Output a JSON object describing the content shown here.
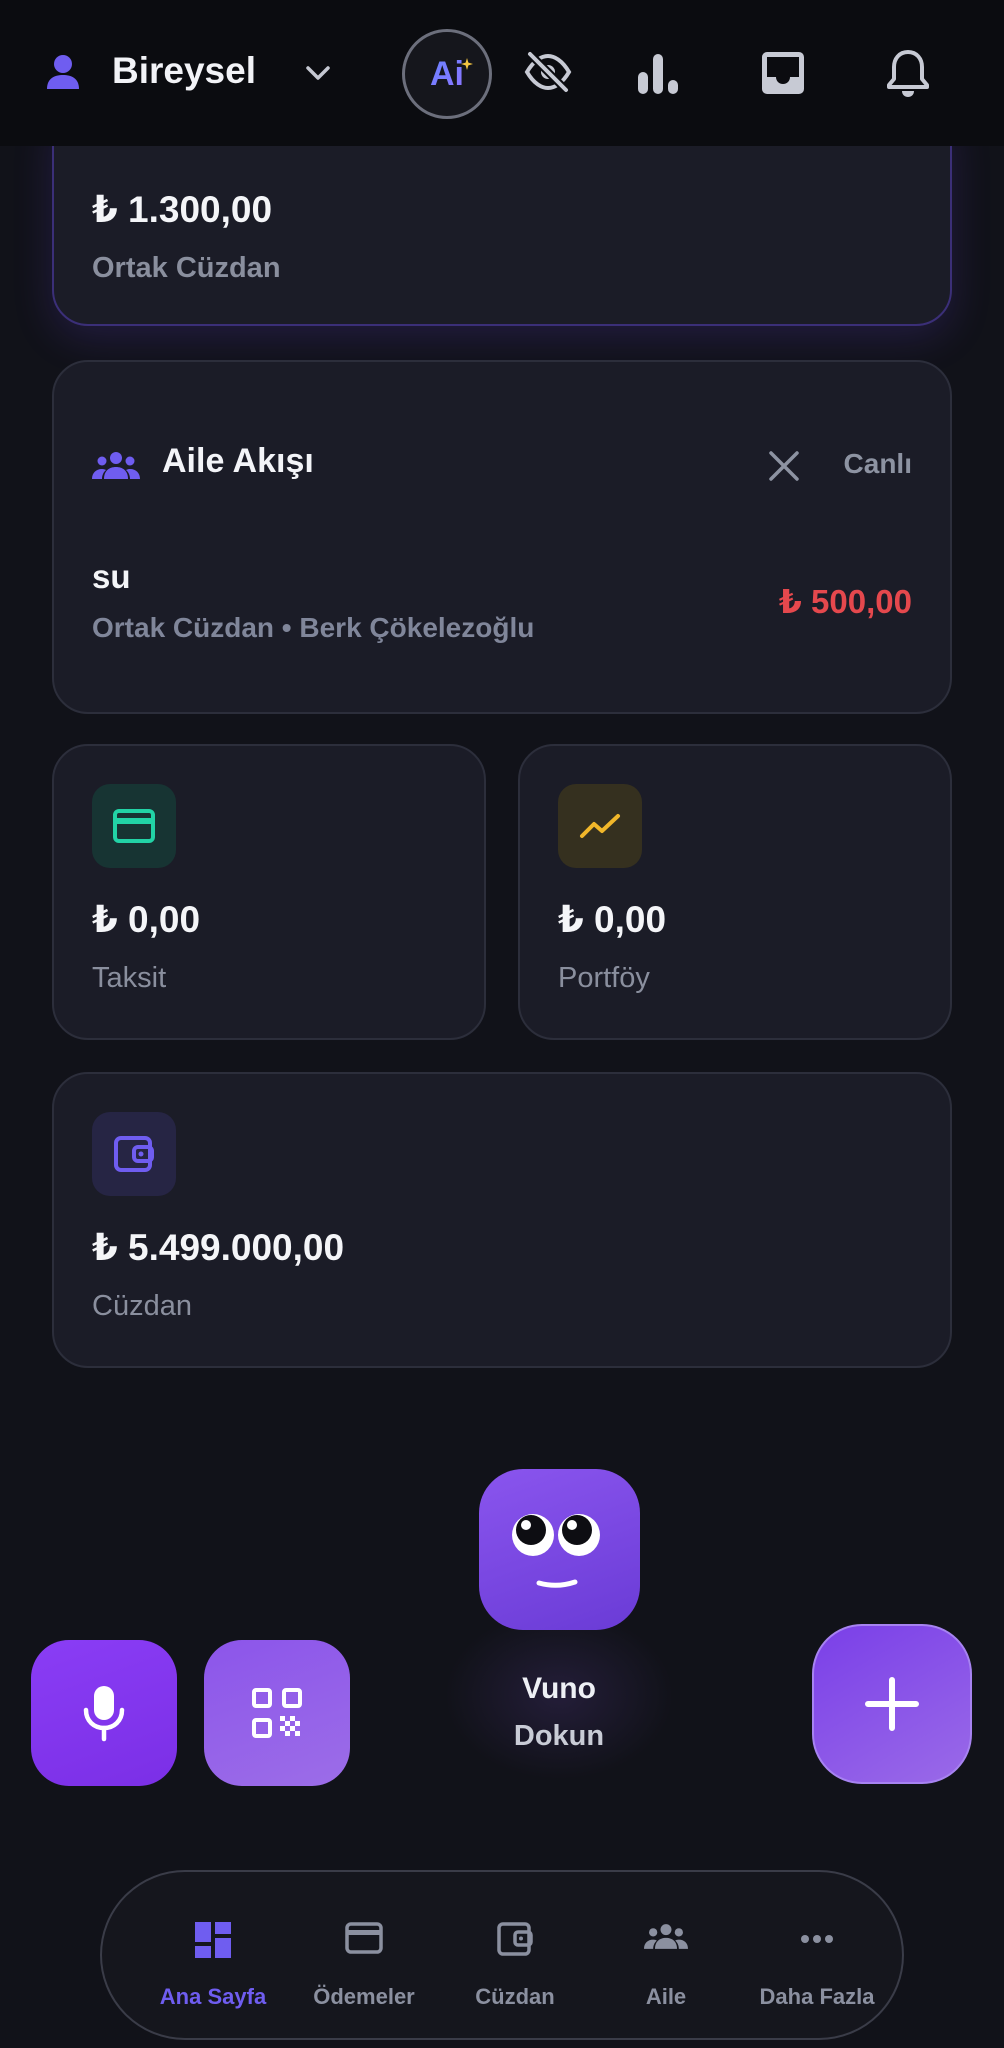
{
  "header": {
    "profile_name": "Bireysel",
    "ai_label": "Ai",
    "icons": [
      "user-icon",
      "chevron-down-icon",
      "ai-icon",
      "eye-off-icon",
      "bar-chart-icon",
      "inbox-icon",
      "bell-icon"
    ]
  },
  "shared_wallet": {
    "amount": "₺ 1.300,00",
    "label": "Ortak Cüzdan"
  },
  "family_flow": {
    "title": "Aile Akışı",
    "status": "Canlı",
    "entry": {
      "name": "su",
      "detail": "Ortak Cüzdan • Berk Çökelezoğlu",
      "amount": "₺ 500,00"
    }
  },
  "stats": {
    "taksit": {
      "amount": "₺ 0,00",
      "label": "Taksit"
    },
    "portfoy": {
      "amount": "₺ 0,00",
      "label": "Portföy"
    },
    "cuzdan": {
      "amount": "₺ 5.499.000,00",
      "label": "Cüzdan"
    }
  },
  "assistant": {
    "name": "Vuno",
    "action": "Dokun"
  },
  "nav": {
    "items": [
      {
        "label": "Ana Sayfa",
        "icon": "dashboard-icon",
        "active": true
      },
      {
        "label": "Ödemeler",
        "icon": "credit-card-icon",
        "active": false
      },
      {
        "label": "Cüzdan",
        "icon": "wallet-icon",
        "active": false
      },
      {
        "label": "Aile",
        "icon": "group-icon",
        "active": false
      },
      {
        "label": "Daha Fazla",
        "icon": "more-horizontal-icon",
        "active": false
      }
    ]
  },
  "colors": {
    "accent": "#6f5df0",
    "negative": "#e5484d",
    "background": "#111219",
    "card": "#1b1c27"
  }
}
